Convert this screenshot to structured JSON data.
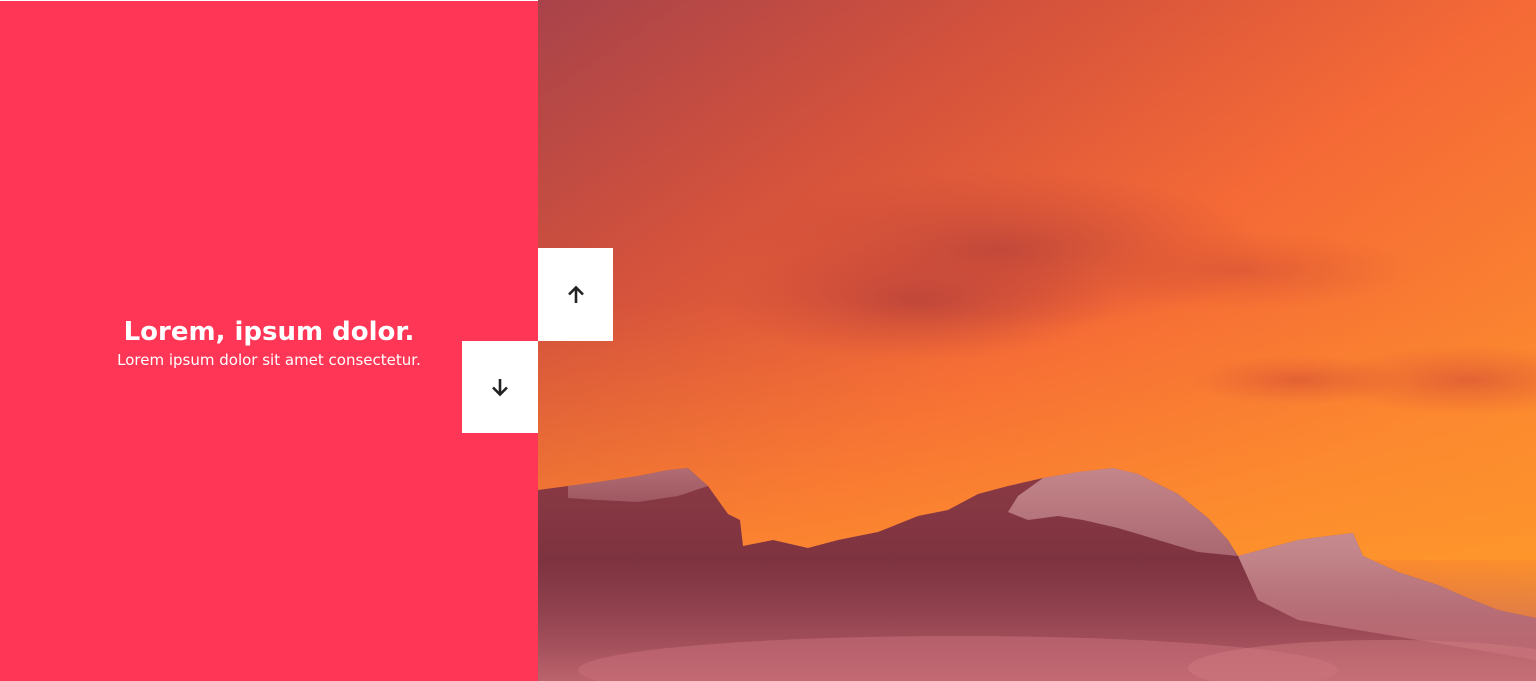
{
  "slide": {
    "title": "Lorem, ipsum dolor.",
    "description": "Lorem ipsum dolor sit amet consectetur."
  },
  "navigation": {
    "up_icon": "arrow-up-icon",
    "down_icon": "arrow-down-icon"
  },
  "image": {
    "subject": "sunset-mountain-landscape"
  },
  "colors": {
    "panel_background": "#ff3656",
    "button_background": "#ffffff",
    "icon_color": "#222222",
    "text_color": "#ffffff"
  }
}
